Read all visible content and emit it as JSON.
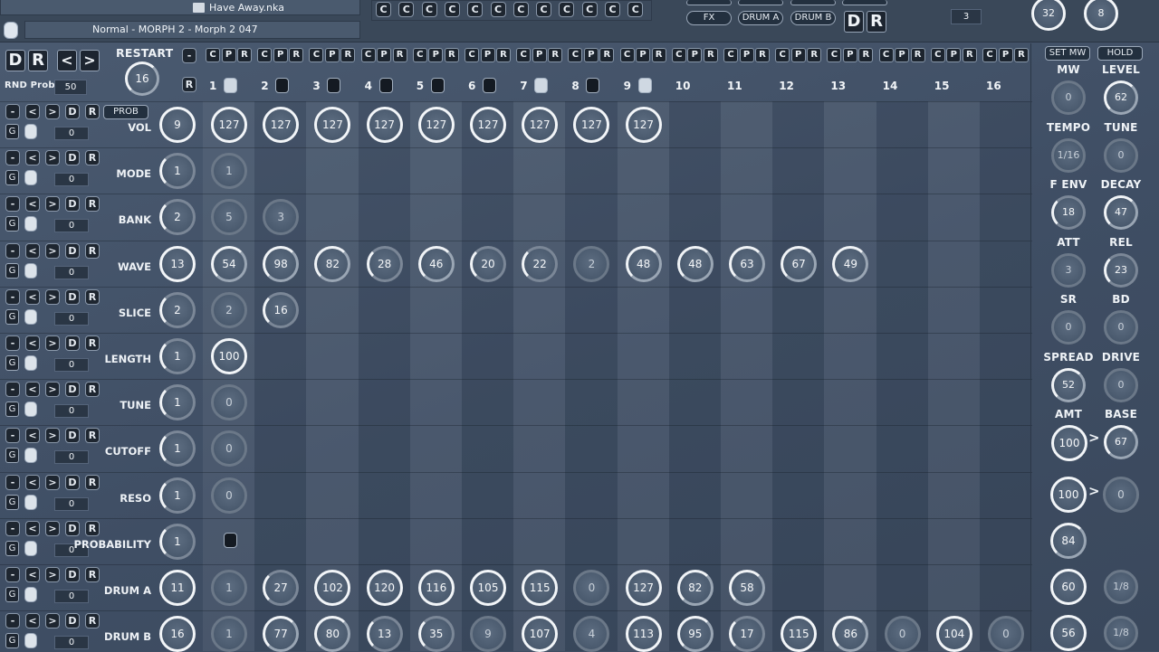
{
  "header": {
    "file_name": "Have Away.nka",
    "preset_name": "Normal - MORPH 2 - Morph 2 047",
    "top_c_buttons": [
      "C",
      "C",
      "C",
      "C",
      "C",
      "C",
      "C",
      "C",
      "C",
      "C",
      "C",
      "C"
    ],
    "fx_label": "FX",
    "drum_a_label": "DRUM A",
    "drum_b_label": "DRUM B",
    "triggers_value": "3",
    "top_knob_1": "32",
    "top_knob_2": "8",
    "d_label": "D",
    "r_label": "R"
  },
  "left_panel": {
    "restart_label": "RESTART",
    "restart_value": "16",
    "rnd_prob_label": "RND Prob",
    "rnd_prob_value": "50",
    "prob_label": "PROB",
    "minus": "-",
    "r": "R"
  },
  "steps": [
    "1",
    "2",
    "3",
    "4",
    "5",
    "6",
    "7",
    "8",
    "9",
    "10",
    "11",
    "12",
    "13",
    "14",
    "15",
    "16"
  ],
  "cpr": [
    "C",
    "P",
    "R"
  ],
  "rows": [
    {
      "label": "VOL",
      "value": "9",
      "cells": [
        "127",
        "127",
        "127",
        "127",
        "127",
        "127",
        "127",
        "127",
        "127"
      ]
    },
    {
      "label": "MODE",
      "value": "1",
      "cells": [
        "1"
      ]
    },
    {
      "label": "BANK",
      "value": "2",
      "cells": [
        "5",
        "3"
      ]
    },
    {
      "label": "WAVE",
      "value": "13",
      "cells": [
        "54",
        "98",
        "82",
        "28",
        "46",
        "20",
        "22",
        "2",
        "48",
        "48",
        "63",
        "67",
        "49"
      ]
    },
    {
      "label": "SLICE",
      "value": "2",
      "cells": [
        "2",
        "16"
      ]
    },
    {
      "label": "LENGTH",
      "value": "1",
      "cells": [
        "100"
      ]
    },
    {
      "label": "TUNE",
      "value": "1",
      "cells": [
        "0"
      ]
    },
    {
      "label": "CUTOFF",
      "value": "1",
      "cells": [
        "0"
      ]
    },
    {
      "label": "RESO",
      "value": "1",
      "cells": [
        "0"
      ]
    },
    {
      "label": "PROBABILITY",
      "value": "1",
      "cells": []
    },
    {
      "label": "DRUM A",
      "value": "11",
      "cells": [
        "1",
        "27",
        "102",
        "120",
        "116",
        "105",
        "115",
        "0",
        "127",
        "82",
        "58"
      ]
    },
    {
      "label": "DRUM B",
      "value": "16",
      "cells": [
        "1",
        "77",
        "80",
        "13",
        "35",
        "9",
        "107",
        "4",
        "113",
        "95",
        "17",
        "115",
        "86",
        "0",
        "104",
        "0"
      ]
    }
  ],
  "row_zero": "0",
  "row_buttons": [
    "-",
    "<",
    ">",
    "D",
    "R"
  ],
  "row_g": "G",
  "right_panel": {
    "set_mw": "SET MW",
    "hold": "HOLD",
    "params": [
      {
        "label": "MW",
        "value": "0"
      },
      {
        "label": "LEVEL",
        "value": "62"
      },
      {
        "label": "TEMPO",
        "value": "1/16"
      },
      {
        "label": "TUNE",
        "value": "0"
      },
      {
        "label": "F ENV",
        "value": "18"
      },
      {
        "label": "DECAY",
        "value": "47"
      },
      {
        "label": "ATT",
        "value": "3"
      },
      {
        "label": "REL",
        "value": "23"
      },
      {
        "label": "SR",
        "value": "0"
      },
      {
        "label": "BD",
        "value": "0"
      },
      {
        "label": "SPREAD",
        "value": "52"
      },
      {
        "label": "DRIVE",
        "value": "0"
      },
      {
        "label": "AMT",
        "value": "100"
      },
      {
        "label": "BASE",
        "value": "67"
      }
    ],
    "morph_arrow": ">",
    "knob_reso_a": "100",
    "knob_reso_b": "0",
    "knob_prob": "84",
    "drum_a_1": "60",
    "drum_a_2": "1/8",
    "drum_b_1": "56",
    "drum_b_2": "1/8"
  },
  "nav": {
    "prev": "<",
    "next": ">"
  }
}
